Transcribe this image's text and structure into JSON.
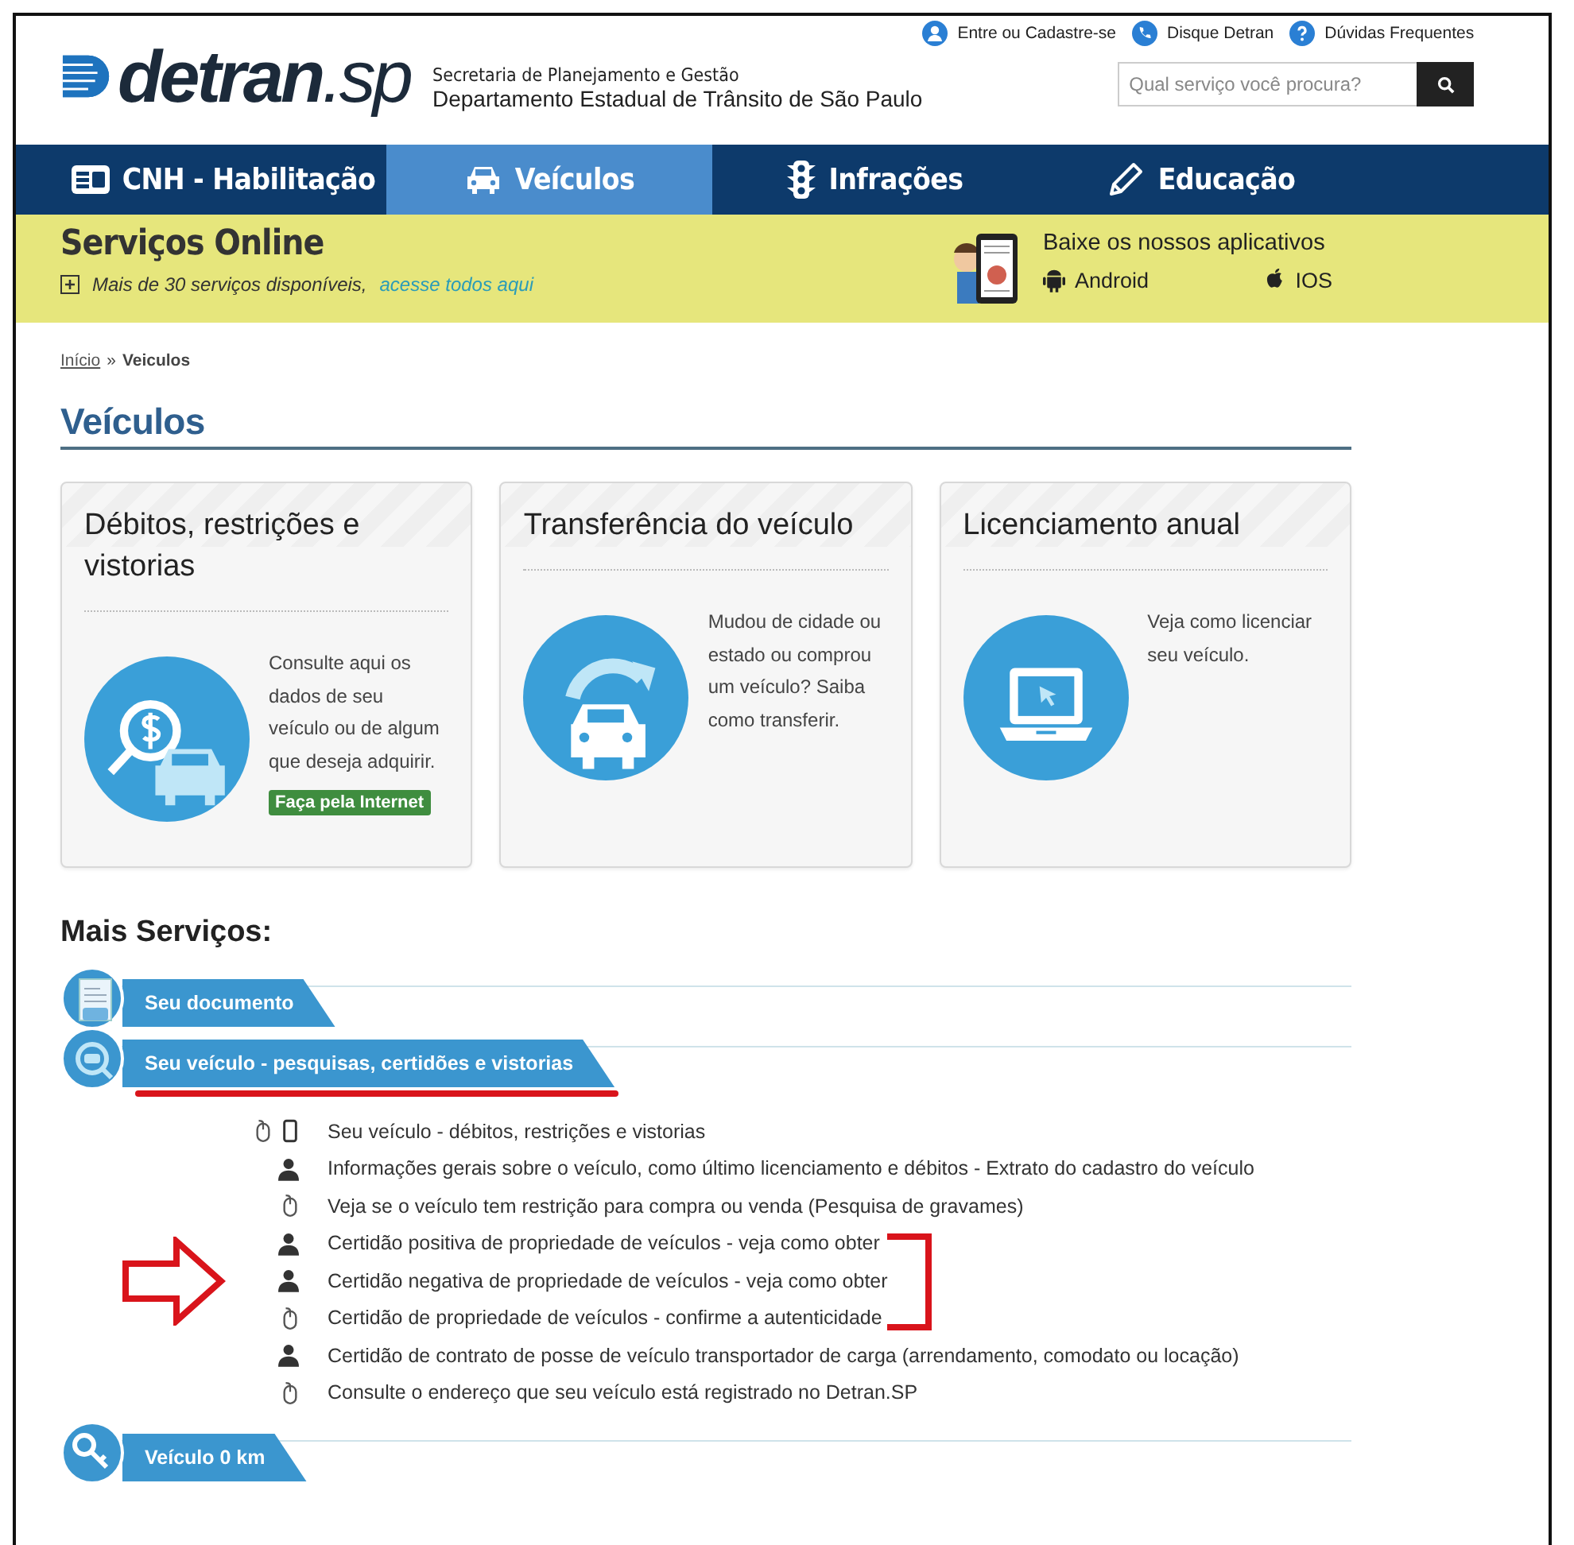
{
  "header": {
    "logo_main": "detran",
    "logo_suffix": ".sp",
    "org_line1": "Secretaria de Planejamento e Gestão",
    "org_line2": "Departamento Estadual de Trânsito de São Paulo",
    "top_links": [
      {
        "kind": "person",
        "label": "Entre ou Cadastre-se"
      },
      {
        "kind": "phone",
        "label": "Disque Detran"
      },
      {
        "kind": "help",
        "label": "Dúvidas Frequentes"
      }
    ],
    "search": {
      "placeholder": "Qual serviço você procura?"
    }
  },
  "nav": [
    {
      "kind": "card",
      "label": "CNH - Habilitação",
      "selected": false
    },
    {
      "kind": "car",
      "label": "Veículos",
      "selected": true
    },
    {
      "kind": "traffic",
      "label": "Infrações",
      "selected": false
    },
    {
      "kind": "pencil",
      "label": "Educação",
      "selected": false
    }
  ],
  "online": {
    "title": "Serviços Online",
    "subtitle": "Mais de 30 serviços disponíveis,",
    "link": "acesse todos aqui",
    "apps_title": "Baixe os nossos aplicativos",
    "apps": [
      {
        "kind": "android",
        "label": "Android"
      },
      {
        "kind": "apple",
        "label": "IOS"
      }
    ]
  },
  "breadcrumb": {
    "home": "Início",
    "separator": "»",
    "current": "Veiculos"
  },
  "page_title": "Veículos",
  "cards": [
    {
      "title": "Débitos, restrições e vistorias",
      "kind": "search",
      "text": "Consulte aqui os dados de seu veículo ou de algum que deseja adquirir.",
      "badge": "Faça pela Internet"
    },
    {
      "title": "Transferência do veículo",
      "kind": "transfer",
      "text": "Mudou de cidade ou estado ou comprou um veículo? Saiba como transferir."
    },
    {
      "title": "Licenciamento anual",
      "kind": "laptop",
      "text": "Veja como licenciar seu veículo."
    }
  ],
  "more_title": "Mais Serviços:",
  "sections": [
    {
      "kind": "document",
      "label": "Seu documento",
      "underlined": false
    },
    {
      "kind": "magnifier",
      "label": "Seu veículo - pesquisas, certidões e vistorias",
      "underlined": true,
      "items": [
        {
          "kind": "online-mobile",
          "label": "Seu veículo - débitos, restrições e vistorias",
          "bracketed": false,
          "pointed": false
        },
        {
          "kind": "in-person",
          "label": "Informações gerais sobre o veículo, como último licenciamento e débitos - Extrato do cadastro do veículo",
          "bracketed": false,
          "pointed": false
        },
        {
          "kind": "online",
          "label": "Veja se o veículo tem restrição para compra ou venda (Pesquisa de gravames)",
          "bracketed": false,
          "pointed": false
        },
        {
          "kind": "in-person",
          "label": "Certidão positiva de propriedade de veículos - veja como obter",
          "bracketed": true,
          "pointed": false
        },
        {
          "kind": "in-person",
          "label": "Certidão negativa de propriedade de veículos - veja como obter",
          "bracketed": true,
          "pointed": true
        },
        {
          "kind": "online",
          "label": "Certidão de propriedade de veículos - confirme a autenticidade",
          "bracketed": true,
          "pointed": false
        },
        {
          "kind": "in-person",
          "label": "Certidão de contrato de posse de veículo transportador de carga (arrendamento, comodato ou locação)",
          "bracketed": false,
          "pointed": false
        },
        {
          "kind": "online",
          "label": "Consulte o endereço que seu veículo está registrado no Detran.SP",
          "bracketed": false,
          "pointed": false
        }
      ]
    },
    {
      "kind": "key",
      "label": "Veículo 0 km",
      "underlined": false
    }
  ]
}
